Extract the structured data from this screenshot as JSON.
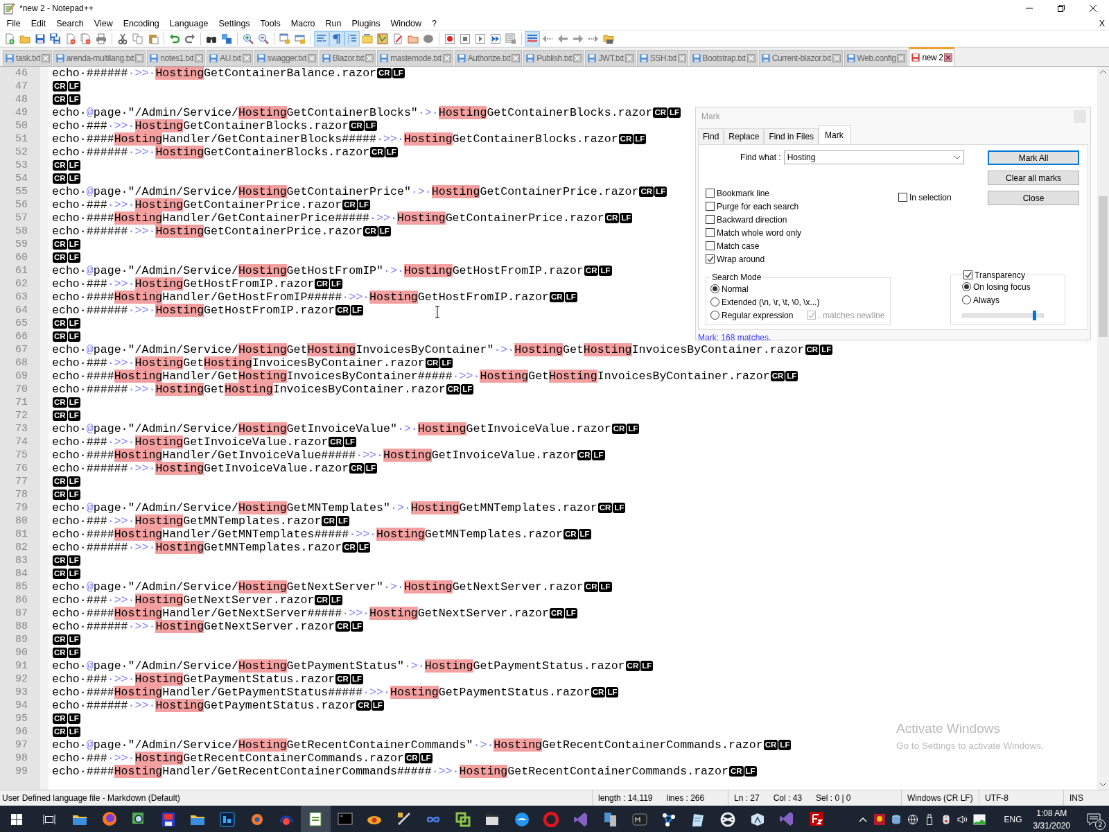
{
  "window": {
    "title": "*new 2 - Notepad++"
  },
  "menu": [
    "File",
    "Edit",
    "Search",
    "View",
    "Encoding",
    "Language",
    "Settings",
    "Tools",
    "Macro",
    "Run",
    "Plugins",
    "Window",
    "?"
  ],
  "menu_close": "X",
  "toolbar": [
    {
      "pressed": false
    },
    {
      "pressed": false
    },
    {
      "pressed": false
    },
    {
      "pressed": false
    },
    {
      "pressed": false
    },
    {
      "pressed": false
    },
    {
      "pressed": false
    },
    {
      "pressed": false
    },
    {
      "pressed": false
    },
    {
      "pressed": false
    },
    {
      "pressed": false
    },
    {
      "pressed": false
    },
    {
      "pressed": false
    },
    {
      "pressed": false
    },
    {
      "pressed": false
    },
    {
      "pressed": false
    },
    {
      "pressed": false
    },
    {
      "pressed": false
    },
    {
      "pressed": true
    },
    {
      "pressed": true
    },
    {
      "pressed": true
    },
    {
      "pressed": false
    },
    {
      "pressed": false
    },
    {
      "pressed": false
    },
    {
      "pressed": false
    },
    {
      "pressed": false
    },
    {
      "pressed": false
    },
    {
      "pressed": false
    },
    {
      "pressed": false
    },
    {
      "pressed": false
    },
    {
      "pressed": false
    },
    {
      "pressed": true
    },
    {
      "pressed": false
    },
    {
      "pressed": false
    },
    {
      "pressed": false
    },
    {
      "pressed": false
    },
    {
      "pressed": false
    }
  ],
  "tabs": [
    {
      "label": "task.txt",
      "selected": false,
      "modified": false
    },
    {
      "label": "arenda-multilang.txt",
      "selected": false,
      "modified": false
    },
    {
      "label": "notes1.txt",
      "selected": false,
      "modified": false
    },
    {
      "label": "AU.txt",
      "selected": false,
      "modified": false
    },
    {
      "label": "swagger.txt",
      "selected": false,
      "modified": false
    },
    {
      "label": "Blazor.txt",
      "selected": false,
      "modified": false
    },
    {
      "label": "mastemode.txt",
      "selected": false,
      "modified": false
    },
    {
      "label": "Authorize.txt",
      "selected": false,
      "modified": false
    },
    {
      "label": "Publish.txt",
      "selected": false,
      "modified": false
    },
    {
      "label": "JWT.txt",
      "selected": false,
      "modified": false
    },
    {
      "label": "SSH.txt",
      "selected": false,
      "modified": false
    },
    {
      "label": "Bootstrap.txt",
      "selected": false,
      "modified": false
    },
    {
      "label": "Current-blazor.txt",
      "selected": false,
      "modified": false
    },
    {
      "label": "Web.config",
      "selected": false,
      "modified": false
    },
    {
      "label": "new 2",
      "selected": true,
      "modified": true
    }
  ],
  "editor": {
    "lines": [
      {
        "number": "46",
        "segments": [
          {
            "kind": "plain",
            "text": "echo·######"
          },
          {
            "kind": "op",
            "text": "·>>·"
          },
          {
            "kind": "mark",
            "text": "Hosting"
          },
          {
            "kind": "plain",
            "text": "GetContainerBalance.razor"
          },
          {
            "kind": "eol",
            "text": "CR"
          },
          {
            "kind": "eol",
            "text": "LF"
          }
        ]
      },
      {
        "number": "47",
        "segments": [
          {
            "kind": "eol",
            "text": "CR"
          },
          {
            "kind": "eol",
            "text": "LF"
          }
        ]
      },
      {
        "number": "48",
        "segments": [
          {
            "kind": "eol",
            "text": "CR"
          },
          {
            "kind": "eol",
            "text": "LF"
          }
        ]
      },
      {
        "number": "49",
        "segments": [
          {
            "kind": "plain",
            "text": "echo·"
          },
          {
            "kind": "op",
            "text": "@"
          },
          {
            "kind": "plain",
            "text": "page·\"/Admin/Service/"
          },
          {
            "kind": "mark",
            "text": "Hosting"
          },
          {
            "kind": "plain",
            "text": "GetContainerBlocks\""
          },
          {
            "kind": "op",
            "text": "·>·"
          },
          {
            "kind": "mark",
            "text": "Hosting"
          },
          {
            "kind": "plain",
            "text": "GetContainerBlocks.razor"
          },
          {
            "kind": "eol",
            "text": "CR"
          },
          {
            "kind": "eol",
            "text": "LF"
          }
        ]
      },
      {
        "number": "50",
        "segments": [
          {
            "kind": "plain",
            "text": "echo·###"
          },
          {
            "kind": "op",
            "text": "·>>·"
          },
          {
            "kind": "mark",
            "text": "Hosting"
          },
          {
            "kind": "plain",
            "text": "GetContainerBlocks.razor"
          },
          {
            "kind": "eol",
            "text": "CR"
          },
          {
            "kind": "eol",
            "text": "LF"
          }
        ]
      },
      {
        "number": "51",
        "segments": [
          {
            "kind": "plain",
            "text": "echo·####"
          },
          {
            "kind": "mark",
            "text": "Hosting"
          },
          {
            "kind": "plain",
            "text": "Handler/GetContainerBlocks#####"
          },
          {
            "kind": "op",
            "text": "·>>·"
          },
          {
            "kind": "mark",
            "text": "Hosting"
          },
          {
            "kind": "plain",
            "text": "GetContainerBlocks.razor"
          },
          {
            "kind": "eol",
            "text": "CR"
          },
          {
            "kind": "eol",
            "text": "LF"
          }
        ]
      },
      {
        "number": "52",
        "segments": [
          {
            "kind": "plain",
            "text": "echo·######"
          },
          {
            "kind": "op",
            "text": "·>>·"
          },
          {
            "kind": "mark",
            "text": "Hosting"
          },
          {
            "kind": "plain",
            "text": "GetContainerBlocks.razor"
          },
          {
            "kind": "eol",
            "text": "CR"
          },
          {
            "kind": "eol",
            "text": "LF"
          }
        ]
      },
      {
        "number": "53",
        "segments": [
          {
            "kind": "eol",
            "text": "CR"
          },
          {
            "kind": "eol",
            "text": "LF"
          }
        ]
      },
      {
        "number": "54",
        "segments": [
          {
            "kind": "eol",
            "text": "CR"
          },
          {
            "kind": "eol",
            "text": "LF"
          }
        ]
      },
      {
        "number": "55",
        "segments": [
          {
            "kind": "plain",
            "text": "echo·"
          },
          {
            "kind": "op",
            "text": "@"
          },
          {
            "kind": "plain",
            "text": "page·\"/Admin/Service/"
          },
          {
            "kind": "mark",
            "text": "Hosting"
          },
          {
            "kind": "plain",
            "text": "GetContainerPrice\""
          },
          {
            "kind": "op",
            "text": "·>·"
          },
          {
            "kind": "mark",
            "text": "Hosting"
          },
          {
            "kind": "plain",
            "text": "GetContainerPrice.razor"
          },
          {
            "kind": "eol",
            "text": "CR"
          },
          {
            "kind": "eol",
            "text": "LF"
          }
        ]
      },
      {
        "number": "56",
        "segments": [
          {
            "kind": "plain",
            "text": "echo·###"
          },
          {
            "kind": "op",
            "text": "·>>·"
          },
          {
            "kind": "mark",
            "text": "Hosting"
          },
          {
            "kind": "plain",
            "text": "GetContainerPrice.razor"
          },
          {
            "kind": "eol",
            "text": "CR"
          },
          {
            "kind": "eol",
            "text": "LF"
          }
        ]
      },
      {
        "number": "57",
        "segments": [
          {
            "kind": "plain",
            "text": "echo·####"
          },
          {
            "kind": "mark",
            "text": "Hosting"
          },
          {
            "kind": "plain",
            "text": "Handler/GetContainerPrice#####"
          },
          {
            "kind": "op",
            "text": "·>>·"
          },
          {
            "kind": "mark",
            "text": "Hosting"
          },
          {
            "kind": "plain",
            "text": "GetContainerPrice.razor"
          },
          {
            "kind": "eol",
            "text": "CR"
          },
          {
            "kind": "eol",
            "text": "LF"
          }
        ]
      },
      {
        "number": "58",
        "segments": [
          {
            "kind": "plain",
            "text": "echo·######"
          },
          {
            "kind": "op",
            "text": "·>>·"
          },
          {
            "kind": "mark",
            "text": "Hosting"
          },
          {
            "kind": "plain",
            "text": "GetContainerPrice.razor"
          },
          {
            "kind": "eol",
            "text": "CR"
          },
          {
            "kind": "eol",
            "text": "LF"
          }
        ]
      },
      {
        "number": "59",
        "segments": [
          {
            "kind": "eol",
            "text": "CR"
          },
          {
            "kind": "eol",
            "text": "LF"
          }
        ]
      },
      {
        "number": "60",
        "segments": [
          {
            "kind": "eol",
            "text": "CR"
          },
          {
            "kind": "eol",
            "text": "LF"
          }
        ]
      },
      {
        "number": "61",
        "segments": [
          {
            "kind": "plain",
            "text": "echo·"
          },
          {
            "kind": "op",
            "text": "@"
          },
          {
            "kind": "plain",
            "text": "page·\"/Admin/Service/"
          },
          {
            "kind": "mark",
            "text": "Hosting"
          },
          {
            "kind": "plain",
            "text": "GetHostFromIP\""
          },
          {
            "kind": "op",
            "text": "·>·"
          },
          {
            "kind": "mark",
            "text": "Hosting"
          },
          {
            "kind": "plain",
            "text": "GetHostFromIP.razor"
          },
          {
            "kind": "eol",
            "text": "CR"
          },
          {
            "kind": "eol",
            "text": "LF"
          }
        ]
      },
      {
        "number": "62",
        "segments": [
          {
            "kind": "plain",
            "text": "echo·###"
          },
          {
            "kind": "op",
            "text": "·>>·"
          },
          {
            "kind": "mark",
            "text": "Hosting"
          },
          {
            "kind": "plain",
            "text": "GetHostFromIP.razor"
          },
          {
            "kind": "eol",
            "text": "CR"
          },
          {
            "kind": "eol",
            "text": "LF"
          }
        ]
      },
      {
        "number": "63",
        "segments": [
          {
            "kind": "plain",
            "text": "echo·####"
          },
          {
            "kind": "mark",
            "text": "Hosting"
          },
          {
            "kind": "plain",
            "text": "Handler/GetHostFromIP#####"
          },
          {
            "kind": "op",
            "text": "·>>·"
          },
          {
            "kind": "mark",
            "text": "Hosting"
          },
          {
            "kind": "plain",
            "text": "GetHostFromIP.razor"
          },
          {
            "kind": "eol",
            "text": "CR"
          },
          {
            "kind": "eol",
            "text": "LF"
          }
        ]
      },
      {
        "number": "64",
        "segments": [
          {
            "kind": "plain",
            "text": "echo·######"
          },
          {
            "kind": "op",
            "text": "·>>·"
          },
          {
            "kind": "mark",
            "text": "Hosting"
          },
          {
            "kind": "plain",
            "text": "GetHostFromIP.razor"
          },
          {
            "kind": "eol",
            "text": "CR"
          },
          {
            "kind": "eol",
            "text": "LF"
          }
        ]
      },
      {
        "number": "65",
        "segments": [
          {
            "kind": "eol",
            "text": "CR"
          },
          {
            "kind": "eol",
            "text": "LF"
          }
        ]
      },
      {
        "number": "66",
        "segments": [
          {
            "kind": "eol",
            "text": "CR"
          },
          {
            "kind": "eol",
            "text": "LF"
          }
        ]
      },
      {
        "number": "67",
        "segments": [
          {
            "kind": "plain",
            "text": "echo·"
          },
          {
            "kind": "op",
            "text": "@"
          },
          {
            "kind": "plain",
            "text": "page·\"/Admin/Service/"
          },
          {
            "kind": "mark",
            "text": "Hosting"
          },
          {
            "kind": "plain",
            "text": "Get"
          },
          {
            "kind": "mark",
            "text": "Hosting"
          },
          {
            "kind": "plain",
            "text": "InvoicesByContainer\""
          },
          {
            "kind": "op",
            "text": "·>·"
          },
          {
            "kind": "mark",
            "text": "Hosting"
          },
          {
            "kind": "plain",
            "text": "Get"
          },
          {
            "kind": "mark",
            "text": "Hosting"
          },
          {
            "kind": "plain",
            "text": "InvoicesByContainer.razor"
          },
          {
            "kind": "eol",
            "text": "CR"
          },
          {
            "kind": "eol",
            "text": "LF"
          }
        ]
      },
      {
        "number": "68",
        "segments": [
          {
            "kind": "plain",
            "text": "echo·###"
          },
          {
            "kind": "op",
            "text": "·>>·"
          },
          {
            "kind": "mark",
            "text": "Hosting"
          },
          {
            "kind": "plain",
            "text": "Get"
          },
          {
            "kind": "mark",
            "text": "Hosting"
          },
          {
            "kind": "plain",
            "text": "InvoicesByContainer.razor"
          },
          {
            "kind": "eol",
            "text": "CR"
          },
          {
            "kind": "eol",
            "text": "LF"
          }
        ]
      },
      {
        "number": "69",
        "segments": [
          {
            "kind": "plain",
            "text": "echo·####"
          },
          {
            "kind": "mark",
            "text": "Hosting"
          },
          {
            "kind": "plain",
            "text": "Handler/Get"
          },
          {
            "kind": "mark",
            "text": "Hosting"
          },
          {
            "kind": "plain",
            "text": "InvoicesByContainer#####"
          },
          {
            "kind": "op",
            "text": "·>>·"
          },
          {
            "kind": "mark",
            "text": "Hosting"
          },
          {
            "kind": "plain",
            "text": "Get"
          },
          {
            "kind": "mark",
            "text": "Hosting"
          },
          {
            "kind": "plain",
            "text": "InvoicesByContainer.razor"
          },
          {
            "kind": "eol",
            "text": "CR"
          },
          {
            "kind": "eol",
            "text": "LF"
          }
        ]
      },
      {
        "number": "70",
        "segments": [
          {
            "kind": "plain",
            "text": "echo·######"
          },
          {
            "kind": "op",
            "text": "·>>·"
          },
          {
            "kind": "mark",
            "text": "Hosting"
          },
          {
            "kind": "plain",
            "text": "Get"
          },
          {
            "kind": "mark",
            "text": "Hosting"
          },
          {
            "kind": "plain",
            "text": "InvoicesByContainer.razor"
          },
          {
            "kind": "eol",
            "text": "CR"
          },
          {
            "kind": "eol",
            "text": "LF"
          }
        ]
      },
      {
        "number": "71",
        "segments": [
          {
            "kind": "eol",
            "text": "CR"
          },
          {
            "kind": "eol",
            "text": "LF"
          }
        ]
      },
      {
        "number": "72",
        "segments": [
          {
            "kind": "eol",
            "text": "CR"
          },
          {
            "kind": "eol",
            "text": "LF"
          }
        ]
      },
      {
        "number": "73",
        "segments": [
          {
            "kind": "plain",
            "text": "echo·"
          },
          {
            "kind": "op",
            "text": "@"
          },
          {
            "kind": "plain",
            "text": "page·\"/Admin/Service/"
          },
          {
            "kind": "mark",
            "text": "Hosting"
          },
          {
            "kind": "plain",
            "text": "GetInvoiceValue\""
          },
          {
            "kind": "op",
            "text": "·>·"
          },
          {
            "kind": "mark",
            "text": "Hosting"
          },
          {
            "kind": "plain",
            "text": "GetInvoiceValue.razor"
          },
          {
            "kind": "eol",
            "text": "CR"
          },
          {
            "kind": "eol",
            "text": "LF"
          }
        ]
      },
      {
        "number": "74",
        "segments": [
          {
            "kind": "plain",
            "text": "echo·###"
          },
          {
            "kind": "op",
            "text": "·>>·"
          },
          {
            "kind": "mark",
            "text": "Hosting"
          },
          {
            "kind": "plain",
            "text": "GetInvoiceValue.razor"
          },
          {
            "kind": "eol",
            "text": "CR"
          },
          {
            "kind": "eol",
            "text": "LF"
          }
        ]
      },
      {
        "number": "75",
        "segments": [
          {
            "kind": "plain",
            "text": "echo·####"
          },
          {
            "kind": "mark",
            "text": "Hosting"
          },
          {
            "kind": "plain",
            "text": "Handler/GetInvoiceValue#####"
          },
          {
            "kind": "op",
            "text": "·>>·"
          },
          {
            "kind": "mark",
            "text": "Hosting"
          },
          {
            "kind": "plain",
            "text": "GetInvoiceValue.razor"
          },
          {
            "kind": "eol",
            "text": "CR"
          },
          {
            "kind": "eol",
            "text": "LF"
          }
        ]
      },
      {
        "number": "76",
        "segments": [
          {
            "kind": "plain",
            "text": "echo·######"
          },
          {
            "kind": "op",
            "text": "·>>·"
          },
          {
            "kind": "mark",
            "text": "Hosting"
          },
          {
            "kind": "plain",
            "text": "GetInvoiceValue.razor"
          },
          {
            "kind": "eol",
            "text": "CR"
          },
          {
            "kind": "eol",
            "text": "LF"
          }
        ]
      },
      {
        "number": "77",
        "segments": [
          {
            "kind": "eol",
            "text": "CR"
          },
          {
            "kind": "eol",
            "text": "LF"
          }
        ]
      },
      {
        "number": "78",
        "segments": [
          {
            "kind": "eol",
            "text": "CR"
          },
          {
            "kind": "eol",
            "text": "LF"
          }
        ]
      },
      {
        "number": "79",
        "segments": [
          {
            "kind": "plain",
            "text": "echo·"
          },
          {
            "kind": "op",
            "text": "@"
          },
          {
            "kind": "plain",
            "text": "page·\"/Admin/Service/"
          },
          {
            "kind": "mark",
            "text": "Hosting"
          },
          {
            "kind": "plain",
            "text": "GetMNTemplates\""
          },
          {
            "kind": "op",
            "text": "·>·"
          },
          {
            "kind": "mark",
            "text": "Hosting"
          },
          {
            "kind": "plain",
            "text": "GetMNTemplates.razor"
          },
          {
            "kind": "eol",
            "text": "CR"
          },
          {
            "kind": "eol",
            "text": "LF"
          }
        ]
      },
      {
        "number": "80",
        "segments": [
          {
            "kind": "plain",
            "text": "echo·###"
          },
          {
            "kind": "op",
            "text": "·>>·"
          },
          {
            "kind": "mark",
            "text": "Hosting"
          },
          {
            "kind": "plain",
            "text": "GetMNTemplates.razor"
          },
          {
            "kind": "eol",
            "text": "CR"
          },
          {
            "kind": "eol",
            "text": "LF"
          }
        ]
      },
      {
        "number": "81",
        "segments": [
          {
            "kind": "plain",
            "text": "echo·####"
          },
          {
            "kind": "mark",
            "text": "Hosting"
          },
          {
            "kind": "plain",
            "text": "Handler/GetMNTemplates#####"
          },
          {
            "kind": "op",
            "text": "·>>·"
          },
          {
            "kind": "mark",
            "text": "Hosting"
          },
          {
            "kind": "plain",
            "text": "GetMNTemplates.razor"
          },
          {
            "kind": "eol",
            "text": "CR"
          },
          {
            "kind": "eol",
            "text": "LF"
          }
        ]
      },
      {
        "number": "82",
        "segments": [
          {
            "kind": "plain",
            "text": "echo·######"
          },
          {
            "kind": "op",
            "text": "·>>·"
          },
          {
            "kind": "mark",
            "text": "Hosting"
          },
          {
            "kind": "plain",
            "text": "GetMNTemplates.razor"
          },
          {
            "kind": "eol",
            "text": "CR"
          },
          {
            "kind": "eol",
            "text": "LF"
          }
        ]
      },
      {
        "number": "83",
        "segments": [
          {
            "kind": "eol",
            "text": "CR"
          },
          {
            "kind": "eol",
            "text": "LF"
          }
        ]
      },
      {
        "number": "84",
        "segments": [
          {
            "kind": "eol",
            "text": "CR"
          },
          {
            "kind": "eol",
            "text": "LF"
          }
        ]
      },
      {
        "number": "85",
        "segments": [
          {
            "kind": "plain",
            "text": "echo·"
          },
          {
            "kind": "op",
            "text": "@"
          },
          {
            "kind": "plain",
            "text": "page·\"/Admin/Service/"
          },
          {
            "kind": "mark",
            "text": "Hosting"
          },
          {
            "kind": "plain",
            "text": "GetNextServer\""
          },
          {
            "kind": "op",
            "text": "·>·"
          },
          {
            "kind": "mark",
            "text": "Hosting"
          },
          {
            "kind": "plain",
            "text": "GetNextServer.razor"
          },
          {
            "kind": "eol",
            "text": "CR"
          },
          {
            "kind": "eol",
            "text": "LF"
          }
        ]
      },
      {
        "number": "86",
        "segments": [
          {
            "kind": "plain",
            "text": "echo·###"
          },
          {
            "kind": "op",
            "text": "·>>·"
          },
          {
            "kind": "mark",
            "text": "Hosting"
          },
          {
            "kind": "plain",
            "text": "GetNextServer.razor"
          },
          {
            "kind": "eol",
            "text": "CR"
          },
          {
            "kind": "eol",
            "text": "LF"
          }
        ]
      },
      {
        "number": "87",
        "segments": [
          {
            "kind": "plain",
            "text": "echo·####"
          },
          {
            "kind": "mark",
            "text": "Hosting"
          },
          {
            "kind": "plain",
            "text": "Handler/GetNextServer#####"
          },
          {
            "kind": "op",
            "text": "·>>·"
          },
          {
            "kind": "mark",
            "text": "Hosting"
          },
          {
            "kind": "plain",
            "text": "GetNextServer.razor"
          },
          {
            "kind": "eol",
            "text": "CR"
          },
          {
            "kind": "eol",
            "text": "LF"
          }
        ]
      },
      {
        "number": "88",
        "segments": [
          {
            "kind": "plain",
            "text": "echo·######"
          },
          {
            "kind": "op",
            "text": "·>>·"
          },
          {
            "kind": "mark",
            "text": "Hosting"
          },
          {
            "kind": "plain",
            "text": "GetNextServer.razor"
          },
          {
            "kind": "eol",
            "text": "CR"
          },
          {
            "kind": "eol",
            "text": "LF"
          }
        ]
      },
      {
        "number": "89",
        "segments": [
          {
            "kind": "eol",
            "text": "CR"
          },
          {
            "kind": "eol",
            "text": "LF"
          }
        ]
      },
      {
        "number": "90",
        "segments": [
          {
            "kind": "eol",
            "text": "CR"
          },
          {
            "kind": "eol",
            "text": "LF"
          }
        ]
      },
      {
        "number": "91",
        "segments": [
          {
            "kind": "plain",
            "text": "echo·"
          },
          {
            "kind": "op",
            "text": "@"
          },
          {
            "kind": "plain",
            "text": "page·\"/Admin/Service/"
          },
          {
            "kind": "mark",
            "text": "Hosting"
          },
          {
            "kind": "plain",
            "text": "GetPaymentStatus\""
          },
          {
            "kind": "op",
            "text": "·>·"
          },
          {
            "kind": "mark",
            "text": "Hosting"
          },
          {
            "kind": "plain",
            "text": "GetPaymentStatus.razor"
          },
          {
            "kind": "eol",
            "text": "CR"
          },
          {
            "kind": "eol",
            "text": "LF"
          }
        ]
      },
      {
        "number": "92",
        "segments": [
          {
            "kind": "plain",
            "text": "echo·###"
          },
          {
            "kind": "op",
            "text": "·>>·"
          },
          {
            "kind": "mark",
            "text": "Hosting"
          },
          {
            "kind": "plain",
            "text": "GetPaymentStatus.razor"
          },
          {
            "kind": "eol",
            "text": "CR"
          },
          {
            "kind": "eol",
            "text": "LF"
          }
        ]
      },
      {
        "number": "93",
        "segments": [
          {
            "kind": "plain",
            "text": "echo·####"
          },
          {
            "kind": "mark",
            "text": "Hosting"
          },
          {
            "kind": "plain",
            "text": "Handler/GetPaymentStatus#####"
          },
          {
            "kind": "op",
            "text": "·>>·"
          },
          {
            "kind": "mark",
            "text": "Hosting"
          },
          {
            "kind": "plain",
            "text": "GetPaymentStatus.razor"
          },
          {
            "kind": "eol",
            "text": "CR"
          },
          {
            "kind": "eol",
            "text": "LF"
          }
        ]
      },
      {
        "number": "94",
        "segments": [
          {
            "kind": "plain",
            "text": "echo·######"
          },
          {
            "kind": "op",
            "text": "·>>·"
          },
          {
            "kind": "mark",
            "text": "Hosting"
          },
          {
            "kind": "plain",
            "text": "GetPaymentStatus.razor"
          },
          {
            "kind": "eol",
            "text": "CR"
          },
          {
            "kind": "eol",
            "text": "LF"
          }
        ]
      },
      {
        "number": "95",
        "segments": [
          {
            "kind": "eol",
            "text": "CR"
          },
          {
            "kind": "eol",
            "text": "LF"
          }
        ]
      },
      {
        "number": "96",
        "segments": [
          {
            "kind": "eol",
            "text": "CR"
          },
          {
            "kind": "eol",
            "text": "LF"
          }
        ]
      },
      {
        "number": "97",
        "segments": [
          {
            "kind": "plain",
            "text": "echo·"
          },
          {
            "kind": "op",
            "text": "@"
          },
          {
            "kind": "plain",
            "text": "page·\"/Admin/Service/"
          },
          {
            "kind": "mark",
            "text": "Hosting"
          },
          {
            "kind": "plain",
            "text": "GetRecentContainerCommands\""
          },
          {
            "kind": "op",
            "text": "·>·"
          },
          {
            "kind": "mark",
            "text": "Hosting"
          },
          {
            "kind": "plain",
            "text": "GetRecentContainerCommands.razor"
          },
          {
            "kind": "eol",
            "text": "CR"
          },
          {
            "kind": "eol",
            "text": "LF"
          }
        ]
      },
      {
        "number": "98",
        "segments": [
          {
            "kind": "plain",
            "text": "echo·###"
          },
          {
            "kind": "op",
            "text": "·>>·"
          },
          {
            "kind": "mark",
            "text": "Hosting"
          },
          {
            "kind": "plain",
            "text": "GetRecentContainerCommands.razor"
          },
          {
            "kind": "eol",
            "text": "CR"
          },
          {
            "kind": "eol",
            "text": "LF"
          }
        ]
      },
      {
        "number": "99",
        "segments": [
          {
            "kind": "plain",
            "text": "echo·####"
          },
          {
            "kind": "mark",
            "text": "Hosting"
          },
          {
            "kind": "plain",
            "text": "Handler/GetRecentContainerCommands#####"
          },
          {
            "kind": "op",
            "text": "·>>·"
          },
          {
            "kind": "mark",
            "text": "Hosting"
          },
          {
            "kind": "plain",
            "text": "GetRecentContainerCommands.razor"
          },
          {
            "kind": "eol",
            "text": "CR"
          },
          {
            "kind": "eol",
            "text": "LF"
          }
        ]
      }
    ]
  },
  "mark_dialog": {
    "title": "Mark",
    "tabs": [
      {
        "label": "Find",
        "selected": false
      },
      {
        "label": "Replace",
        "selected": false
      },
      {
        "label": "Find in Files",
        "selected": false
      },
      {
        "label": "Mark",
        "selected": true
      }
    ],
    "find_label": "Find what :",
    "find_value": "Hosting",
    "buttons": [
      {
        "label": "Mark All",
        "default": true
      },
      {
        "label": "Clear all marks",
        "default": false
      },
      {
        "label": "Close",
        "default": false
      }
    ],
    "options": [
      {
        "label": "Bookmark line",
        "checked": false
      },
      {
        "label": "Purge for each search",
        "checked": false
      },
      {
        "label": "Backward direction",
        "checked": false
      },
      {
        "label": "Match whole word only",
        "checked": false
      },
      {
        "label": "Match case",
        "checked": false
      },
      {
        "label": "Wrap around",
        "checked": true
      }
    ],
    "in_selection": {
      "label": "In selection",
      "checked": false
    },
    "search_mode": {
      "title": "Search Mode",
      "modes": [
        {
          "label": "Normal",
          "selected": true
        },
        {
          "label": "Extended (\\n, \\r, \\t, \\0, \\x...)",
          "selected": false
        },
        {
          "label": "Regular expression",
          "selected": false
        }
      ],
      "newline_option": {
        "label": ". matches newline",
        "checked": true,
        "disabled": true
      }
    },
    "transparency": {
      "label": "Transparency",
      "checked": true,
      "modes": [
        {
          "label": "On losing focus",
          "selected": true
        },
        {
          "label": "Always",
          "selected": false
        }
      ],
      "level": 0.9
    },
    "status": "Mark: 168 matches."
  },
  "watermark_notice": {
    "title": "Activate Windows",
    "text": "Go to Settings to activate Windows."
  },
  "status_bar": {
    "language": "User Defined language file - Markdown (Default)",
    "length": "length : 14,119",
    "lines": "lines : 266",
    "line": "Ln : 27",
    "column": "Col : 43",
    "selection": "Sel : 0 | 0",
    "eol": "Windows (CR LF)",
    "encoding": "UTF-8",
    "mode": "INS"
  },
  "taskbar": {
    "apps": [
      {
        "running": false,
        "selected": false
      },
      {
        "running": true,
        "selected": false
      },
      {
        "running": true,
        "selected": false
      },
      {
        "running": false,
        "selected": false
      },
      {
        "running": false,
        "selected": false
      },
      {
        "running": false,
        "selected": false
      },
      {
        "running": false,
        "selected": false
      },
      {
        "running": false,
        "selected": false
      },
      {
        "running": true,
        "selected": true
      },
      {
        "running": true,
        "selected": false
      },
      {
        "running": false,
        "selected": false
      },
      {
        "running": true,
        "selected": false
      },
      {
        "running": false,
        "selected": false
      },
      {
        "running": false,
        "selected": false
      },
      {
        "running": true,
        "selected": false
      },
      {
        "running": false,
        "selected": false
      },
      {
        "running": false,
        "selected": false
      },
      {
        "running": false,
        "selected": false
      },
      {
        "running": false,
        "selected": false
      },
      {
        "running": false,
        "selected": false
      },
      {
        "running": false,
        "selected": false
      },
      {
        "running": false,
        "selected": false
      },
      {
        "running": false,
        "selected": false
      },
      {
        "running": false,
        "selected": false
      },
      {
        "running": true,
        "selected": false
      },
      {
        "running": true,
        "selected": false
      }
    ],
    "language": "ENG",
    "time": "1:08 AM",
    "date": "3/31/2020",
    "notifications": "2"
  }
}
